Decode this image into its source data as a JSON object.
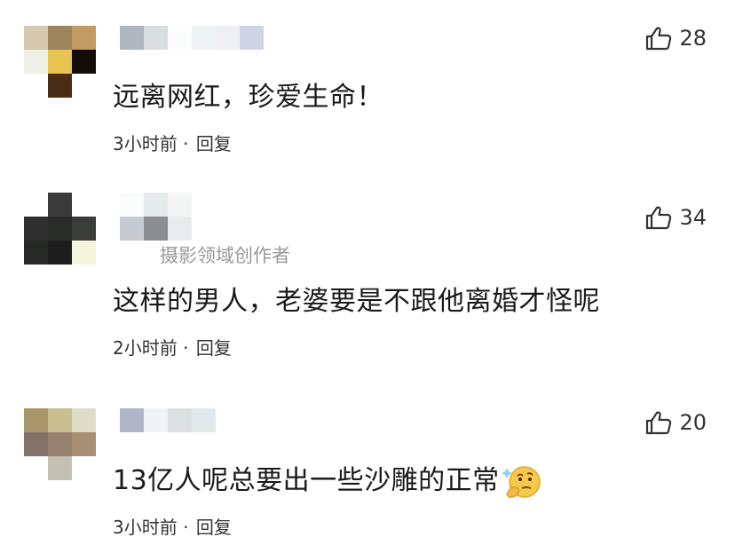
{
  "comments": [
    {
      "text": "远离网红，珍爱生命！",
      "likes": "28",
      "time": "3小时前",
      "reply": "回复",
      "subtitle": ""
    },
    {
      "text": "这样的男人，老婆要是不跟他离婚才怪呢",
      "likes": "34",
      "time": "2小时前",
      "reply": "回复",
      "subtitle": "摄影领域创作者"
    },
    {
      "text": "13亿人呢总要出一些沙雕的正常",
      "likes": "20",
      "time": "3小时前",
      "reply": "回复",
      "subtitle": ""
    }
  ],
  "meta_separator": "·",
  "icons": {
    "like": "thumbs-up-icon",
    "emoji": "thinking-face-emoji-icon"
  },
  "colors": {
    "text": "#1a1a1a",
    "meta": "#333333",
    "subtitle": "#9a9a9a"
  }
}
